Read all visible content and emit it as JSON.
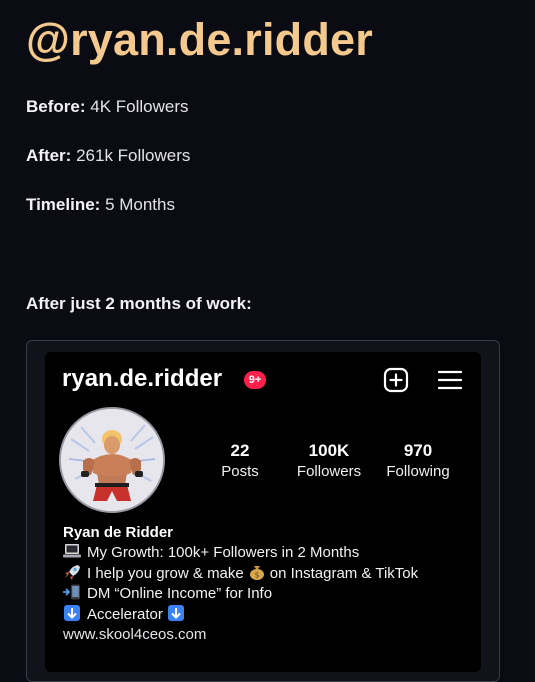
{
  "header": {
    "handle": "@ryan.de.ridder"
  },
  "stats": [
    {
      "label": "Before:",
      "value": "4K Followers"
    },
    {
      "label": "After:",
      "value": "261k Followers"
    },
    {
      "label": "Timeline:",
      "value": "5 Months"
    }
  ],
  "subheading": "After just 2 months of work:",
  "instagram": {
    "username": "ryan.de.ridder",
    "notification_badge": "9+",
    "icons": {
      "new_post": "plus-square-icon",
      "menu": "hamburger-menu-icon"
    },
    "counts": [
      {
        "value": "22",
        "label": "Posts"
      },
      {
        "value": "100K",
        "label": "Followers"
      },
      {
        "value": "970",
        "label": "Following"
      }
    ],
    "bio": {
      "name": "Ryan de Ridder",
      "line1": "My Growth: 100k+ Followers in 2 Months",
      "line1_icon": "laptop-emoji",
      "line2_before": "I help you grow & make",
      "line2_after": "on Instagram & TikTok",
      "line2_icon": "rocket-emoji",
      "line2_inline_icon": "money-bag-emoji",
      "line3": "DM “Online Income” for Info",
      "line3_icon": "phone-arrow-emoji",
      "line4": "Accelerator",
      "line4_icon": "down-arrow-emoji",
      "link": "www.skool4ceos.com"
    },
    "colors": {
      "badge": "#ff1f4b",
      "handle_accent": "#f3c98e"
    }
  }
}
